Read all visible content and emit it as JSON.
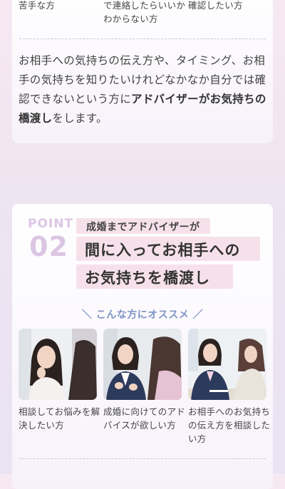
{
  "top_card": {
    "captions": [
      "苦手な方",
      "で連絡したらいいか\nわからない方",
      "確認したい方"
    ],
    "desc_parts": [
      "お相手への気持ちの伝え方や、タイミング、お相手の気持ちを知りたいけれどなかなか自分では確認できないという方に",
      "アドバイザーがお気持ちの橋渡し",
      "をします。"
    ]
  },
  "point_card": {
    "point_word": "POINT",
    "point_number": "02",
    "subtitle": "成婚までアドバイザーが",
    "title_line1": "間に入ってお相手への",
    "title_line2": "お気持ちを橋渡し",
    "recommend": "＼ こんな方にオススメ ／",
    "cases": [
      {
        "caption": "相談してお悩みを解決したい方",
        "image": "woman-thinking-photo"
      },
      {
        "caption": "成婚に向けてのアドバイスが欲しい方",
        "image": "consultation-photo"
      },
      {
        "caption": "お相手へのお気持ちの伝え方を相談したい方",
        "image": "meeting-photo"
      }
    ]
  },
  "colors": {
    "accent_point": "#dcc6e4",
    "highlight": "#f6e1ea",
    "recommend_text": "#7e93c5"
  }
}
